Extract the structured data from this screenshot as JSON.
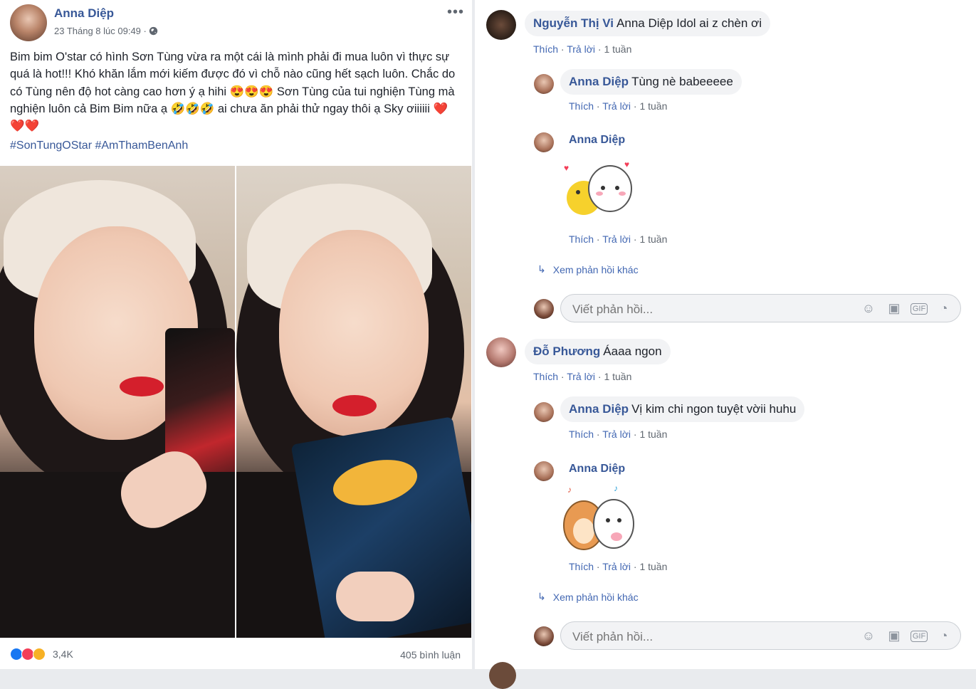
{
  "post": {
    "author": "Anna Diệp",
    "time": "23 Tháng 8 lúc 09:49 · ",
    "privacy_icon": "globe-icon",
    "text": "Bim bim O'star có hình Sơn Tùng vừa ra một cái là mình phải đi mua luôn vì thực sự quá là hot!!! Khó khăn lắm mới kiếm được đó vì chỗ nào cũng hết sạch luôn. Chắc do có Tùng nên độ hot càng cao hơn ý ạ hihi 😍😍😍 Sơn Tùng của tui nghiện Tùng mà nghiện luôn cả Bim Bim nữa ạ 🤣🤣🤣 ai chưa ăn phải thử ngay thôi ạ Sky ơiiiiii ❤️❤️❤️",
    "hashtags": "#SonTungOStar #AmThamBenAnh",
    "reaction_count": "3,4K",
    "comment_count": "405 bình luận",
    "more_label": "•••"
  },
  "comments": {
    "c1": {
      "name": "Nguyễn Thị Vi",
      "text": "Anna Diệp Idol ai z chèn ơi",
      "like": "Thích",
      "reply": "Trả lời",
      "time": "1 tuần"
    },
    "r1": {
      "name": "Anna Diệp",
      "text": "Tùng nè babeeeee",
      "like": "Thích",
      "reply": "Trả lời",
      "time": "1 tuần"
    },
    "r2": {
      "name": "Anna Diệp",
      "like": "Thích",
      "reply": "Trả lời",
      "time": "1 tuần"
    },
    "more1": "Xem phản hồi khác",
    "c2": {
      "name": "Đỗ Phương",
      "text": "Áaaa ngon",
      "like": "Thích",
      "reply": "Trả lời",
      "time": "1 tuần"
    },
    "r3": {
      "name": "Anna Diệp",
      "text": "Vị kim chi ngon tuyệt vờii huhu",
      "like": "Thích",
      "reply": "Trả lời",
      "time": "1 tuần"
    },
    "r4": {
      "name": "Anna Diệp",
      "like": "Thích",
      "reply": "Trả lời",
      "time": "1 tuần"
    },
    "more2": "Xem phản hồi khác",
    "reply_placeholder": "Viết phản hồi..."
  },
  "colors": {
    "link": "#385898",
    "meta": "#606770",
    "bubble": "#f2f3f5",
    "like": "#1877f2",
    "love": "#f33e58",
    "wow": "#f7b125"
  }
}
